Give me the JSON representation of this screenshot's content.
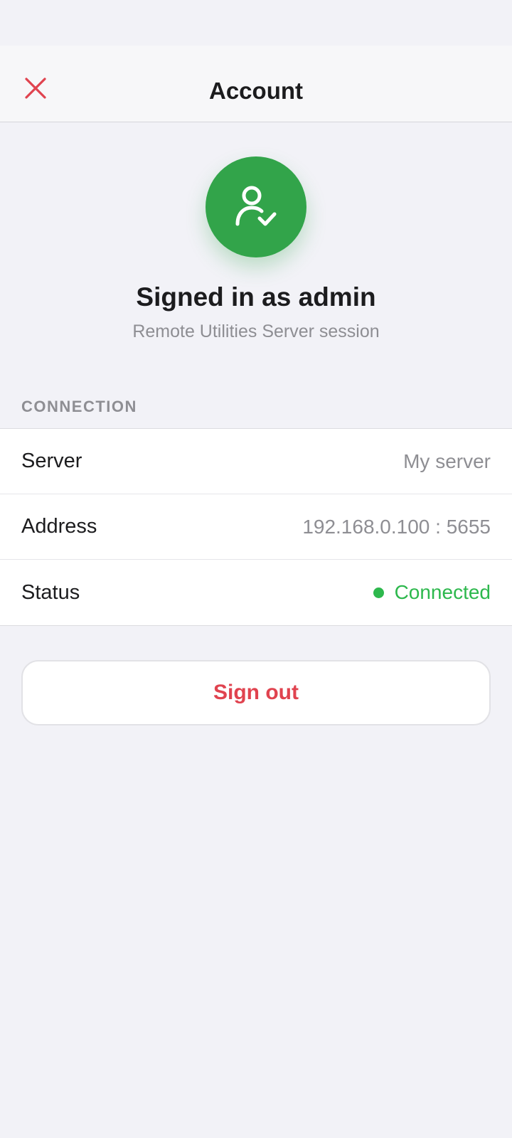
{
  "header": {
    "title": "Account",
    "close_icon": "close-icon"
  },
  "profile": {
    "icon": "user-check-icon",
    "title": "Signed in as admin",
    "subtitle": "Remote Utilities Server session"
  },
  "connection": {
    "section_label": "CONNECTION",
    "rows": [
      {
        "label": "Server",
        "value": "My server"
      },
      {
        "label": "Address",
        "value": "192.168.0.100 : 5655"
      },
      {
        "label": "Status",
        "value": "Connected"
      }
    ]
  },
  "actions": {
    "sign_out_label": "Sign out"
  },
  "colors": {
    "accent_red": "#e0434f",
    "avatar_green": "#32a44a",
    "status_green": "#2db84d",
    "muted_text": "#8e8e93"
  }
}
